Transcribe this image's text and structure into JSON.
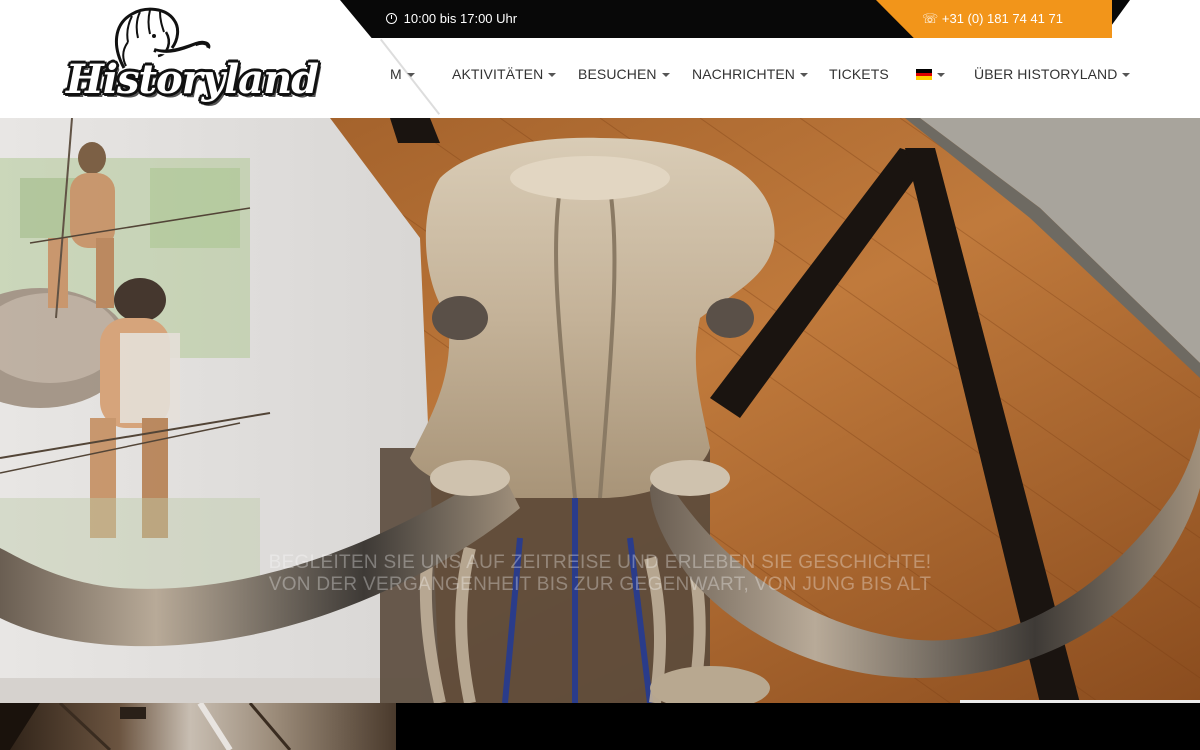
{
  "brand": {
    "logo_text": "Historyland",
    "logo_icon": "mammoth-icon"
  },
  "topbar": {
    "hours_icon": "clock-icon",
    "hours": "10:00 bis 17:00 Uhr",
    "phone_icon": "phone-icon",
    "phone": "☏ +31 (0) 181 74 41 71",
    "colors": {
      "bar": "#080808",
      "accent": "#f2951a"
    }
  },
  "nav": {
    "items": [
      {
        "label": "M"
      },
      {
        "label": "AKTIVITÄTEN"
      },
      {
        "label": "BESUCHEN"
      },
      {
        "label": "NACHRICHTEN"
      },
      {
        "label": "TICKETS"
      },
      {
        "label": ""
      },
      {
        "label": "ÜBER HISTORYLAND"
      }
    ],
    "language_icon": "german-flag-icon",
    "dropdown_icon": "chevron-down-icon"
  },
  "hero": {
    "image": "mammoth-skeleton-photo",
    "slogan_line1": "BEGLEITEN SIE UNS AUF ZEITREISE UND ERLEBEN SIE GESCHICHTE!",
    "slogan_line2": "VON DER VERGANGENHEIT BIS ZUR GEGENWART, VON JUNG BIS ALT"
  },
  "bottom": {
    "thumbnail": "museum-interior-photo"
  }
}
